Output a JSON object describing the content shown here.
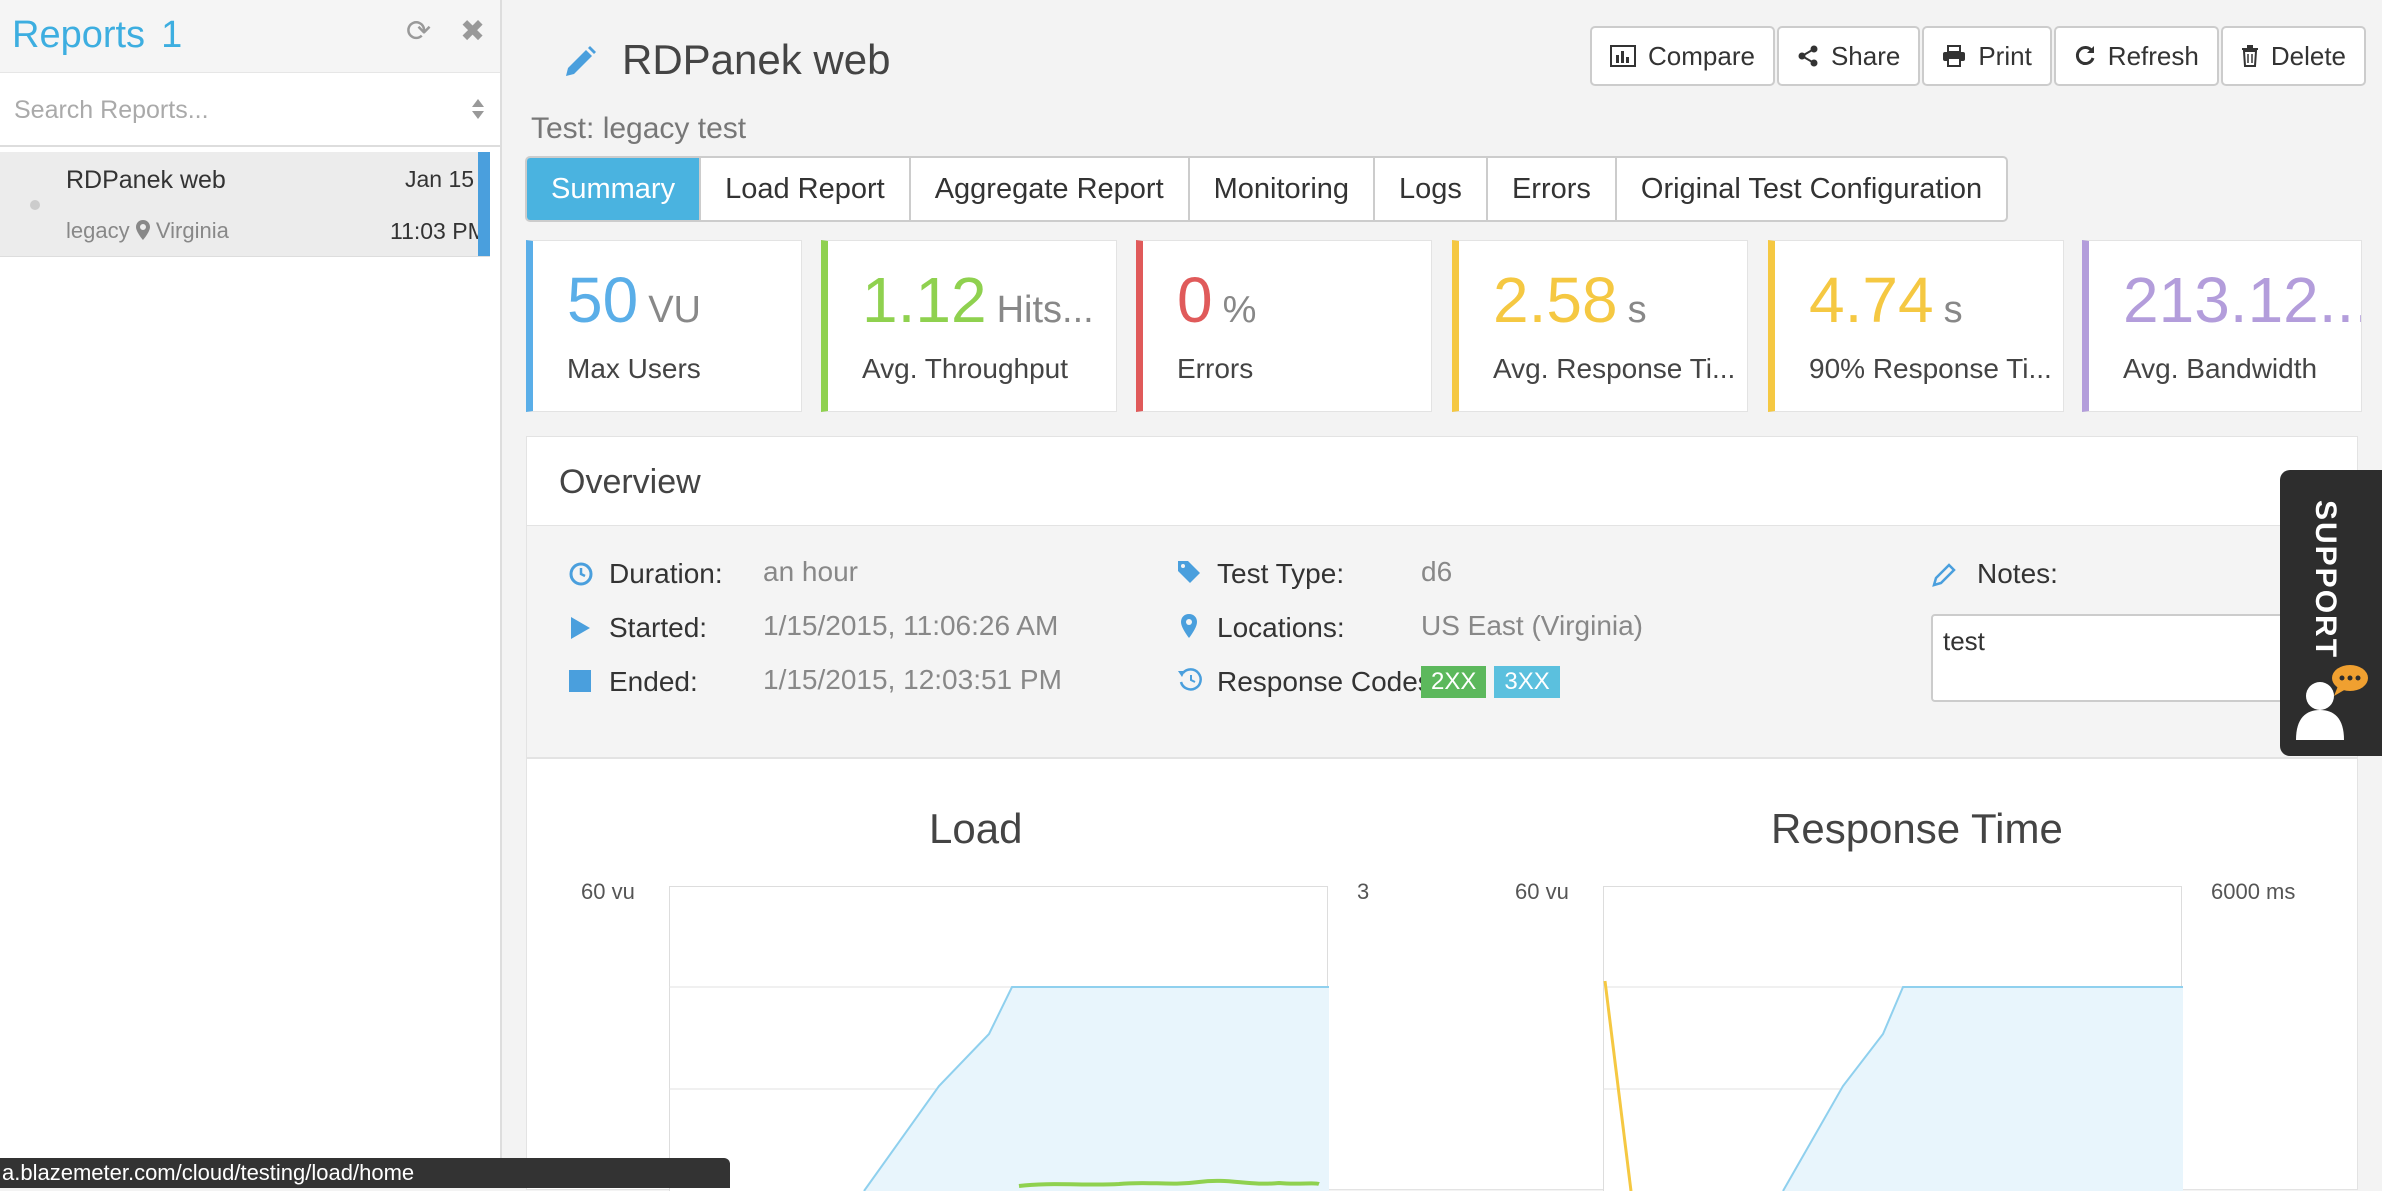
{
  "sidebar": {
    "title": "Reports",
    "count": "1",
    "search_placeholder": "Search Reports...",
    "report": {
      "name": "RDPanek web",
      "date": "Jan 15",
      "tag": "legacy",
      "location": "Virginia",
      "time": "11:03 PM"
    }
  },
  "statusbar": {
    "url": "a.blazemeter.com/cloud/testing/load/home"
  },
  "header": {
    "title": "RDPanek web",
    "subtitle": "Test: legacy test",
    "buttons": [
      "Compare",
      "Share",
      "Print",
      "Refresh",
      "Delete"
    ]
  },
  "tabs": [
    "Summary",
    "Load Report",
    "Aggregate Report",
    "Monitoring",
    "Logs",
    "Errors",
    "Original Test Configuration"
  ],
  "kpis": [
    {
      "value": "50",
      "unit": "VU",
      "label": "Max Users",
      "color": "#5aaee8"
    },
    {
      "value": "1.12",
      "unit": "Hits...",
      "label": "Avg. Throughput",
      "color": "#8fd14f"
    },
    {
      "value": "0",
      "unit": "%",
      "label": "Errors",
      "color": "#e05a5a"
    },
    {
      "value": "2.58",
      "unit": "s",
      "label": "Avg. Response Ti...",
      "color": "#f5c842"
    },
    {
      "value": "4.74",
      "unit": "s",
      "label": "90% Response Ti...",
      "color": "#f5c842"
    },
    {
      "value": "213.12...",
      "unit": "",
      "label": "Avg. Bandwidth",
      "color": "#b39ddb"
    }
  ],
  "overview": {
    "title": "Overview",
    "duration_label": "Duration:",
    "duration": "an hour",
    "started_label": "Started:",
    "started": "1/15/2015, 11:06:26 AM",
    "ended_label": "Ended:",
    "ended": "1/15/2015, 12:03:51 PM",
    "test_type_label": "Test Type:",
    "test_type": "d6",
    "locations_label": "Locations:",
    "locations": "US East (Virginia)",
    "response_codes_label": "Response Codes:",
    "response_codes": [
      "2XX",
      "3XX"
    ],
    "notes_label": "Notes:",
    "notes": "test"
  },
  "charts": {
    "load": {
      "title": "Load",
      "left_max": "60 vu",
      "right_max": "3"
    },
    "response": {
      "title": "Response Time",
      "left_max": "60 vu",
      "right_max": "6000 ms"
    }
  },
  "support": {
    "label": "SUPPORT"
  },
  "colors": {
    "accent": "#4ab3e0",
    "code_2xx": "#5cb85c",
    "code_3xx": "#5bc0de"
  }
}
